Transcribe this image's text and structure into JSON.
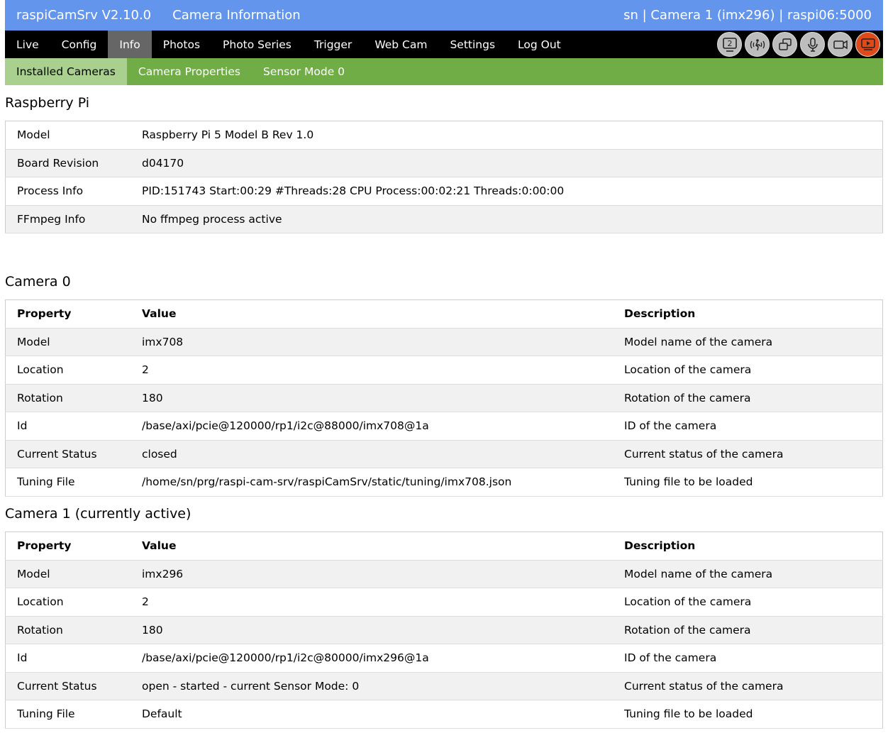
{
  "header": {
    "app": "raspiCamSrv V2.10.0",
    "page": "Camera Information",
    "context": "sn | Camera 1 (imx296) | raspi06:5000"
  },
  "nav": {
    "items": [
      "Live",
      "Config",
      "Info",
      "Photos",
      "Photo Series",
      "Trigger",
      "Web Cam",
      "Settings",
      "Log Out"
    ],
    "active": "Info",
    "icons": [
      "camera-2-icon",
      "motion-detect-icon",
      "multi-camera-icon",
      "microphone-icon",
      "video-camera-icon",
      "stream-icon"
    ]
  },
  "subnav": {
    "items": [
      "Installed Cameras",
      "Camera Properties",
      "Sensor Mode 0"
    ],
    "active": "Installed Cameras"
  },
  "pi": {
    "title": "Raspberry Pi",
    "rows": [
      [
        "Model",
        "Raspberry Pi 5 Model B Rev 1.0"
      ],
      [
        "Board Revision",
        "d04170"
      ],
      [
        "Process Info",
        "PID:151743 Start:00:29 #Threads:28 CPU Process:00:02:21 Threads:0:00:00"
      ],
      [
        "FFmpeg Info",
        "No ffmpeg process active"
      ]
    ]
  },
  "headers": [
    "Property",
    "Value",
    "Description"
  ],
  "cam0": {
    "title": "Camera 0",
    "rows": [
      [
        "Model",
        "imx708",
        "Model name of the camera"
      ],
      [
        "Location",
        "2",
        "Location of the camera"
      ],
      [
        "Rotation",
        "180",
        "Rotation of the camera"
      ],
      [
        "Id",
        "/base/axi/pcie@120000/rp1/i2c@88000/imx708@1a",
        "ID of the camera"
      ],
      [
        "Current Status",
        "closed",
        "Current status of the camera"
      ],
      [
        "Tuning File",
        "/home/sn/prg/raspi-cam-srv/raspiCamSrv/static/tuning/imx708.json",
        "Tuning file to be loaded"
      ]
    ]
  },
  "cam1": {
    "title": "Camera 1 (currently active)",
    "rows": [
      [
        "Model",
        "imx296",
        "Model name of the camera"
      ],
      [
        "Location",
        "2",
        "Location of the camera"
      ],
      [
        "Rotation",
        "180",
        "Rotation of the camera"
      ],
      [
        "Id",
        "/base/axi/pcie@120000/rp1/i2c@80000/imx296@1a",
        "ID of the camera"
      ],
      [
        "Current Status",
        "open - started - current Sensor Mode: 0",
        "Current status of the camera"
      ],
      [
        "Tuning File",
        "Default",
        "Tuning file to be loaded"
      ]
    ]
  },
  "colors": {
    "header": "#6495ed",
    "nav": "#000000",
    "nav_active": "#666666",
    "subnav": "#70ad47",
    "subnav_active": "#a9d08e",
    "stream_icon": "#e04a1a"
  }
}
